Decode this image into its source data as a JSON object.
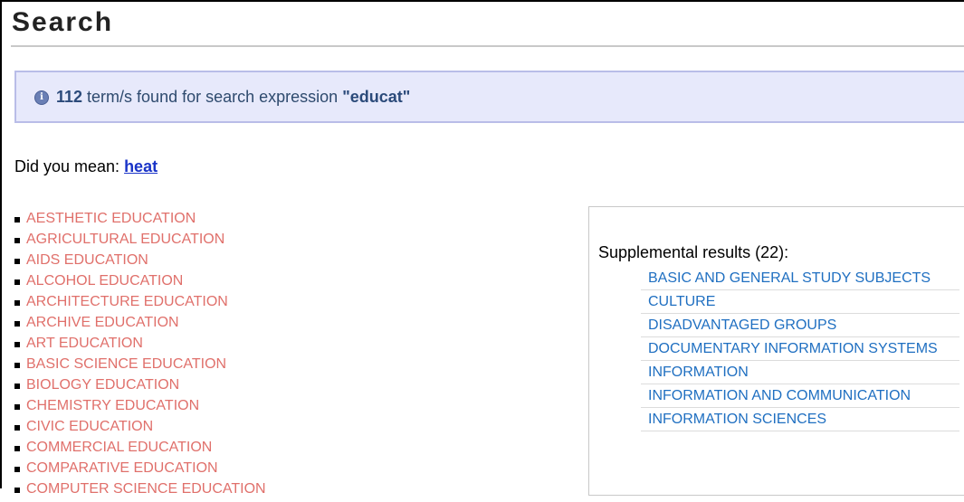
{
  "page": {
    "title": "Search"
  },
  "info": {
    "count": "112",
    "text_before": " term/s found for search expression ",
    "expression": "\"educat\""
  },
  "suggestion": {
    "label": "Did you mean: ",
    "term": "heat"
  },
  "terms": [
    "AESTHETIC EDUCATION",
    "AGRICULTURAL EDUCATION",
    "AIDS EDUCATION",
    "ALCOHOL EDUCATION",
    "ARCHITECTURE EDUCATION",
    "ARCHIVE EDUCATION",
    "ART EDUCATION",
    "BASIC SCIENCE EDUCATION",
    "BIOLOGY EDUCATION",
    "CHEMISTRY EDUCATION",
    "CIVIC EDUCATION",
    "COMMERCIAL EDUCATION",
    "COMPARATIVE EDUCATION",
    "COMPUTER SCIENCE EDUCATION"
  ],
  "supplemental": {
    "title": "Supplemental results (22):",
    "items": [
      "BASIC AND GENERAL STUDY SUBJECTS",
      "CULTURE",
      "DISADVANTAGED GROUPS",
      "DOCUMENTARY INFORMATION SYSTEMS",
      "INFORMATION",
      "INFORMATION AND COMMUNICATION",
      "INFORMATION SCIENCES"
    ]
  },
  "colors": {
    "term_link": "#e0706b",
    "supplemental_link": "#1f6fc1",
    "suggestion_link": "#1a34c8",
    "info_background": "#e7e9fb"
  },
  "icons": {
    "info": "info-circle-icon"
  }
}
